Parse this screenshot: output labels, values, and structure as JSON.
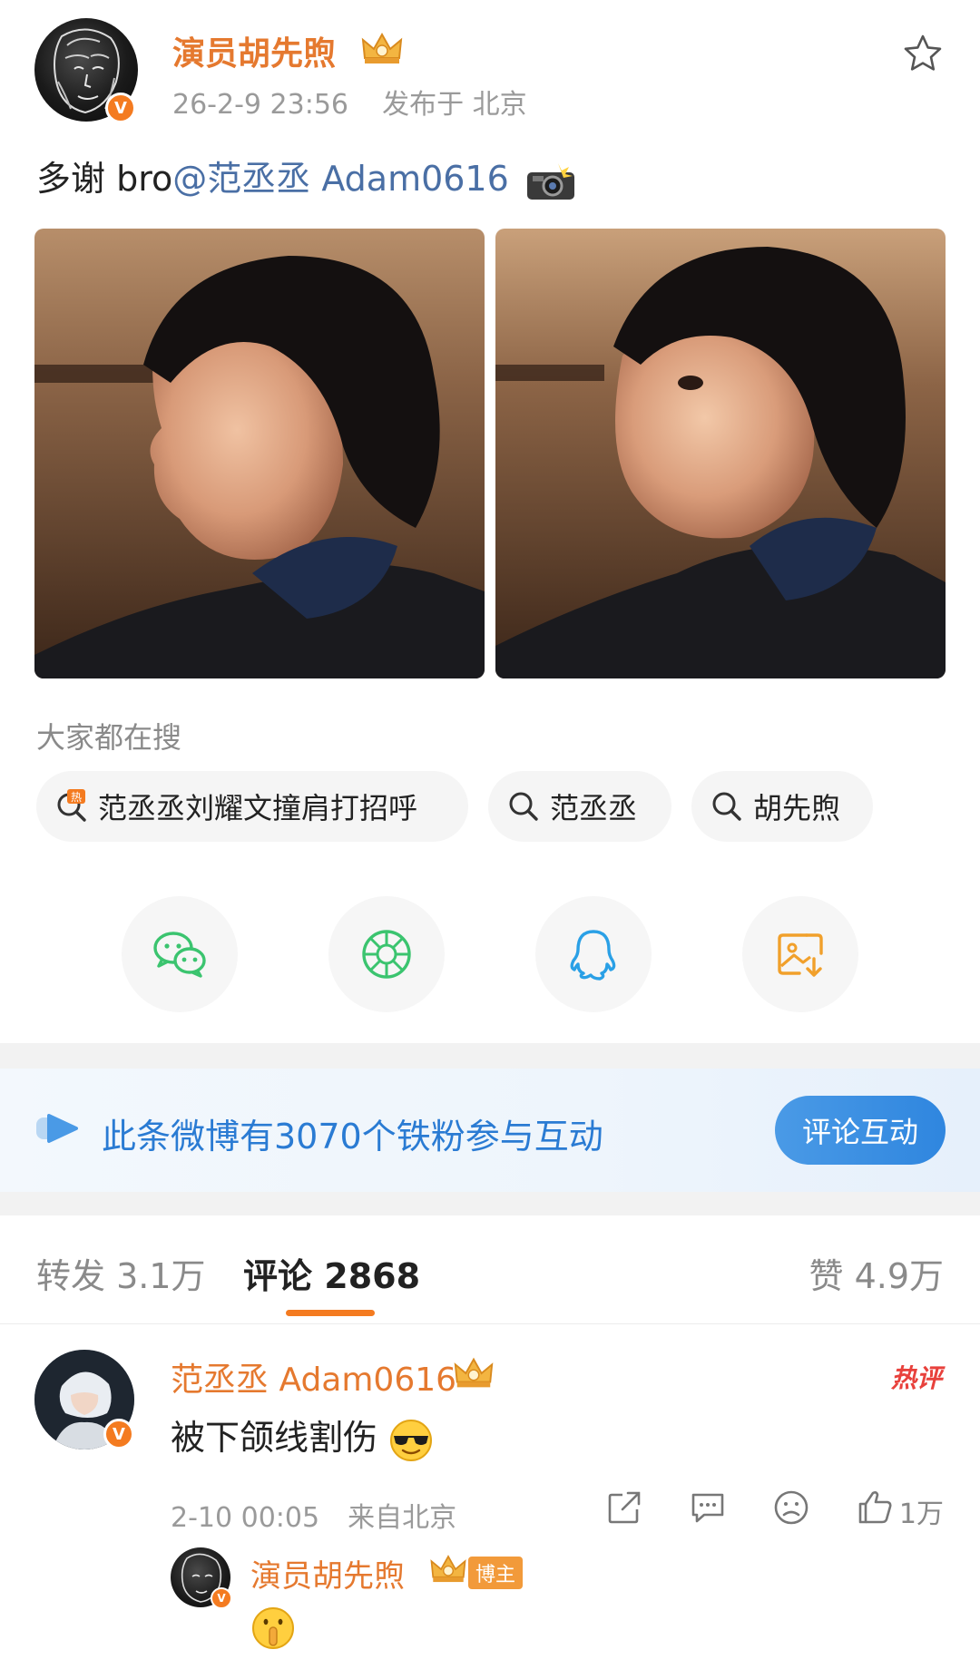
{
  "post": {
    "author": "演员胡先煦",
    "avatar_badge": "V",
    "date": "26-2-9 23:56",
    "location": "发布于 北京",
    "text_prefix": "多谢 bro",
    "mention": "@范丞丞 Adam0616",
    "photos": [
      "photo-1",
      "photo-2"
    ]
  },
  "search": {
    "title": "大家都在搜",
    "chips": [
      {
        "label": "范丞丞刘耀文撞肩打招呼",
        "icon": "hot-search-icon"
      },
      {
        "label": "范丞丞",
        "icon": "search-icon"
      },
      {
        "label": "胡先煦",
        "icon": "search-icon"
      }
    ]
  },
  "share": {
    "items": [
      "wechat-icon",
      "moments-icon",
      "qq-icon",
      "save-image-icon"
    ]
  },
  "fans": {
    "text": "此条微博有3070个铁粉参与互动",
    "button": "评论互动"
  },
  "tabs": {
    "repost_label": "转发",
    "repost_count": "3.1万",
    "comment_label": "评论",
    "comment_count": "2868",
    "like_label": "赞",
    "like_count": "4.9万"
  },
  "comment": {
    "author": "范丞丞 Adam0616",
    "avatar_badge": "V",
    "hot_tag": "热评",
    "text": "被下颌线割伤",
    "time": "2-10 00:05",
    "location": "来自北京",
    "like_count": "1万"
  },
  "reply": {
    "author": "演员胡先煦",
    "host_badge": "博主"
  },
  "colors": {
    "name_orange": "#e5792f",
    "link_blue": "#4a6fa5",
    "accent_orange": "#f47b20",
    "fans_blue": "#2a7bd3"
  }
}
